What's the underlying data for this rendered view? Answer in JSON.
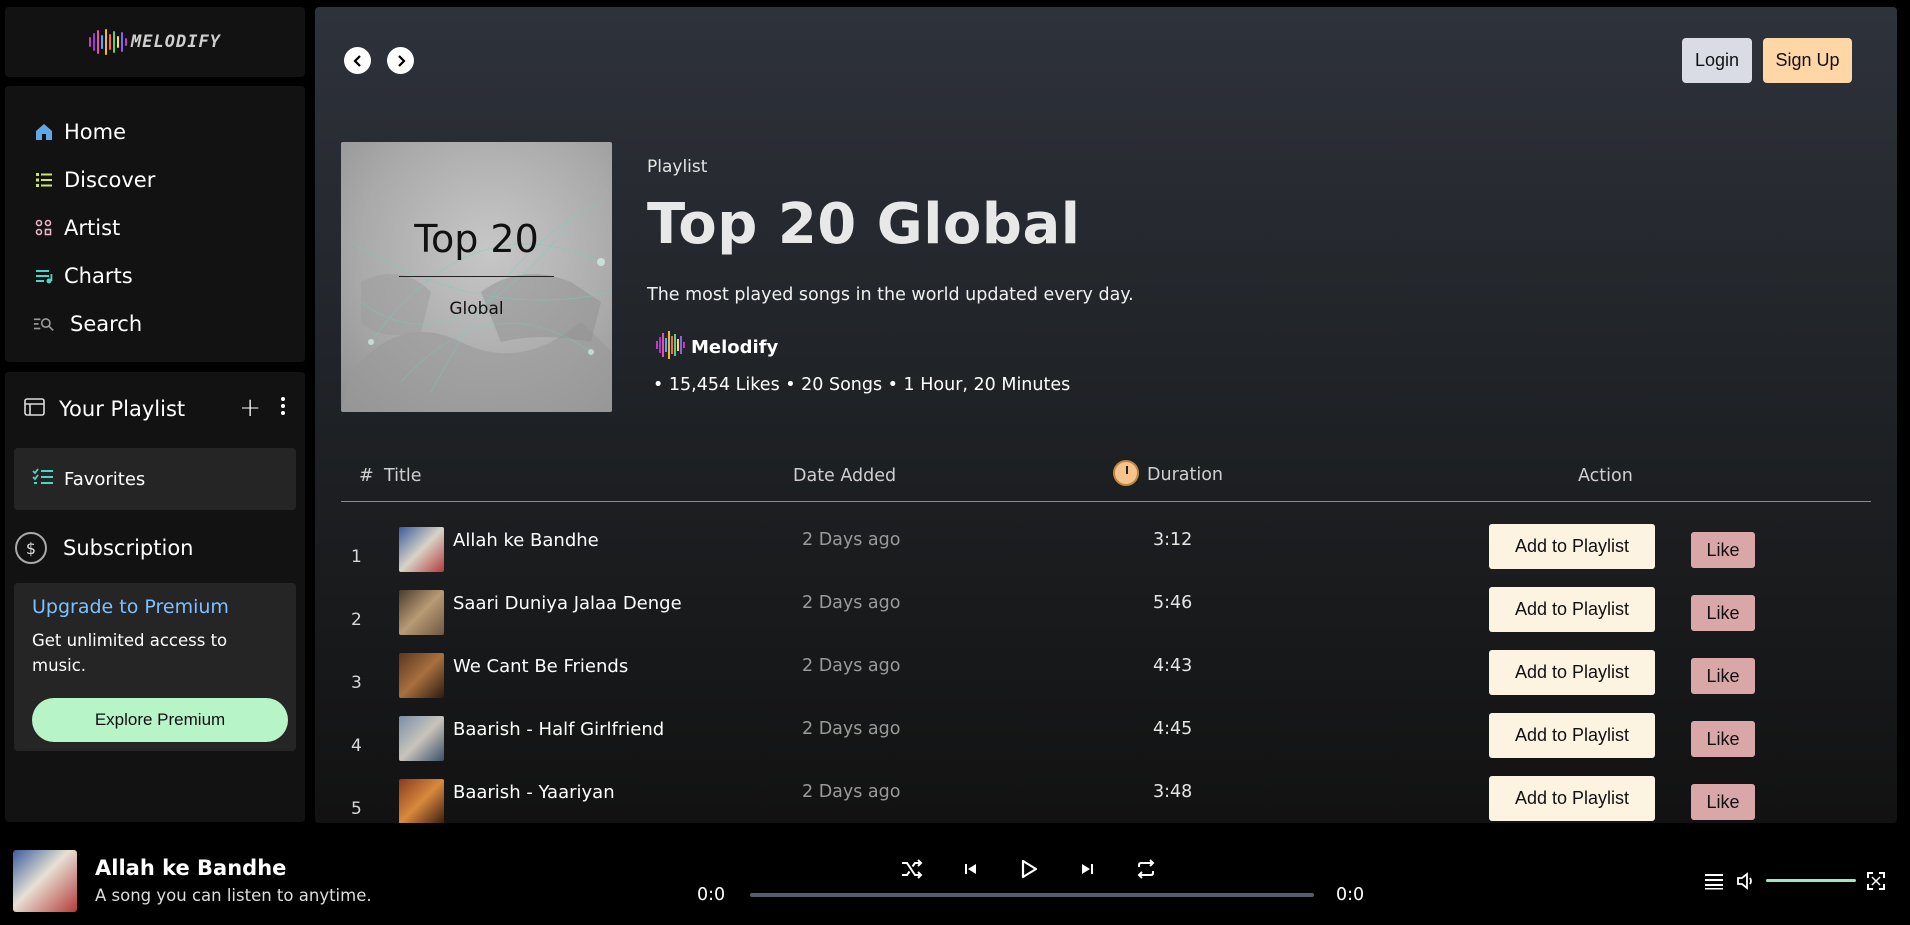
{
  "app": {
    "logo_text": "MELODIFY",
    "logo_bar_colors": [
      "#c13cc0",
      "#9b3ad8",
      "#e94fa3",
      "#4ea8ff",
      "#f0b93b",
      "#ff6a3d",
      "#56d27a",
      "#e8e84a",
      "#8c5cff",
      "#c13cc0"
    ]
  },
  "nav": {
    "items": [
      {
        "label": "Home",
        "icon": "home-icon"
      },
      {
        "label": "Discover",
        "icon": "list-icon"
      },
      {
        "label": "Artist",
        "icon": "grid-icon"
      },
      {
        "label": "Charts",
        "icon": "queue-music-icon"
      },
      {
        "label": "Search",
        "icon": "search-list-icon"
      }
    ]
  },
  "library": {
    "title": "Your Playlist",
    "add_label": "+",
    "favorites_label": "Favorites",
    "subscription_label": "Subscription",
    "subscription_icon": "$",
    "premium": {
      "title": "Upgrade to Premium",
      "description": "Get unlimited access to music.",
      "button_label": "Explore Premium"
    }
  },
  "header": {
    "back_icon": "<",
    "forward_icon": ">",
    "login_label": "Login",
    "signup_label": "Sign Up"
  },
  "playlist": {
    "cover_title": "Top 20",
    "cover_subtitle": "Global",
    "kind": "Playlist",
    "title": "Top 20 Global",
    "description": "The most played songs in the world updated every day.",
    "owner": "Melodify",
    "stats": "•  15,454 Likes •  20 Songs •  1 Hour, 20 Minutes"
  },
  "table": {
    "headers": {
      "num": "#",
      "title": "Title",
      "date": "Date Added",
      "duration": "Duration",
      "action": "Action"
    },
    "rows": [
      {
        "num": "1",
        "title": "Allah ke Bandhe",
        "date": "2 Days ago",
        "duration": "3:12",
        "add": "Add to Playlist",
        "like": "Like",
        "thumb_colors": [
          "#3a5c9c",
          "#d8d3c6",
          "#b43a3a"
        ]
      },
      {
        "num": "2",
        "title": "Saari Duniya Jalaa Denge",
        "date": "2 Days ago",
        "duration": "5:46",
        "add": "Add to Playlist",
        "like": "Like",
        "thumb_colors": [
          "#4a3b2e",
          "#b89b75",
          "#6e5641"
        ]
      },
      {
        "num": "3",
        "title": "We Cant Be Friends",
        "date": "2 Days ago",
        "duration": "4:43",
        "add": "Add to Playlist",
        "like": "Like",
        "thumb_colors": [
          "#5b3620",
          "#a8703f",
          "#2d1a10"
        ]
      },
      {
        "num": "4",
        "title": "Baarish - Half Girlfriend",
        "date": "2 Days ago",
        "duration": "4:45",
        "add": "Add to Playlist",
        "like": "Like",
        "thumb_colors": [
          "#7a8fa8",
          "#c9c4bc",
          "#3b4e68"
        ]
      },
      {
        "num": "5",
        "title": "Baarish - Yaariyan",
        "date": "2 Days ago",
        "duration": "3:48",
        "add": "Add to Playlist",
        "like": "Like",
        "thumb_colors": [
          "#8a3a1e",
          "#d98a3c",
          "#3a1a0e"
        ]
      }
    ]
  },
  "player": {
    "title": "Allah ke Bandhe",
    "subtitle": "A song you can listen to anytime.",
    "time_current": "0:0",
    "time_total": "0:0",
    "progress": 0,
    "volume": 1.0
  },
  "colors": {
    "accent_green": "#b7f4c8",
    "premium_link": "#7ec0ff",
    "add_button": "#fdf3e1",
    "like_button": "#d9a7a8",
    "signup_button": "#ffd6a5",
    "login_button": "#d9dce5"
  }
}
